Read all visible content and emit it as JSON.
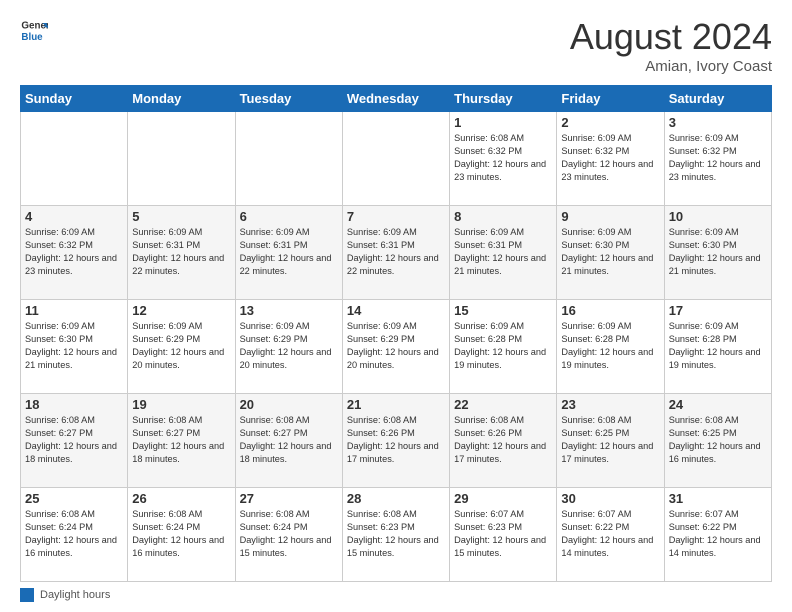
{
  "header": {
    "logo_line1": "General",
    "logo_line2": "Blue",
    "month_year": "August 2024",
    "location": "Amian, Ivory Coast"
  },
  "days_of_week": [
    "Sunday",
    "Monday",
    "Tuesday",
    "Wednesday",
    "Thursday",
    "Friday",
    "Saturday"
  ],
  "weeks": [
    [
      {
        "day": "",
        "info": ""
      },
      {
        "day": "",
        "info": ""
      },
      {
        "day": "",
        "info": ""
      },
      {
        "day": "",
        "info": ""
      },
      {
        "day": "1",
        "info": "Sunrise: 6:08 AM\nSunset: 6:32 PM\nDaylight: 12 hours\nand 23 minutes."
      },
      {
        "day": "2",
        "info": "Sunrise: 6:09 AM\nSunset: 6:32 PM\nDaylight: 12 hours\nand 23 minutes."
      },
      {
        "day": "3",
        "info": "Sunrise: 6:09 AM\nSunset: 6:32 PM\nDaylight: 12 hours\nand 23 minutes."
      }
    ],
    [
      {
        "day": "4",
        "info": "Sunrise: 6:09 AM\nSunset: 6:32 PM\nDaylight: 12 hours\nand 23 minutes."
      },
      {
        "day": "5",
        "info": "Sunrise: 6:09 AM\nSunset: 6:31 PM\nDaylight: 12 hours\nand 22 minutes."
      },
      {
        "day": "6",
        "info": "Sunrise: 6:09 AM\nSunset: 6:31 PM\nDaylight: 12 hours\nand 22 minutes."
      },
      {
        "day": "7",
        "info": "Sunrise: 6:09 AM\nSunset: 6:31 PM\nDaylight: 12 hours\nand 22 minutes."
      },
      {
        "day": "8",
        "info": "Sunrise: 6:09 AM\nSunset: 6:31 PM\nDaylight: 12 hours\nand 21 minutes."
      },
      {
        "day": "9",
        "info": "Sunrise: 6:09 AM\nSunset: 6:30 PM\nDaylight: 12 hours\nand 21 minutes."
      },
      {
        "day": "10",
        "info": "Sunrise: 6:09 AM\nSunset: 6:30 PM\nDaylight: 12 hours\nand 21 minutes."
      }
    ],
    [
      {
        "day": "11",
        "info": "Sunrise: 6:09 AM\nSunset: 6:30 PM\nDaylight: 12 hours\nand 21 minutes."
      },
      {
        "day": "12",
        "info": "Sunrise: 6:09 AM\nSunset: 6:29 PM\nDaylight: 12 hours\nand 20 minutes."
      },
      {
        "day": "13",
        "info": "Sunrise: 6:09 AM\nSunset: 6:29 PM\nDaylight: 12 hours\nand 20 minutes."
      },
      {
        "day": "14",
        "info": "Sunrise: 6:09 AM\nSunset: 6:29 PM\nDaylight: 12 hours\nand 20 minutes."
      },
      {
        "day": "15",
        "info": "Sunrise: 6:09 AM\nSunset: 6:28 PM\nDaylight: 12 hours\nand 19 minutes."
      },
      {
        "day": "16",
        "info": "Sunrise: 6:09 AM\nSunset: 6:28 PM\nDaylight: 12 hours\nand 19 minutes."
      },
      {
        "day": "17",
        "info": "Sunrise: 6:09 AM\nSunset: 6:28 PM\nDaylight: 12 hours\nand 19 minutes."
      }
    ],
    [
      {
        "day": "18",
        "info": "Sunrise: 6:08 AM\nSunset: 6:27 PM\nDaylight: 12 hours\nand 18 minutes."
      },
      {
        "day": "19",
        "info": "Sunrise: 6:08 AM\nSunset: 6:27 PM\nDaylight: 12 hours\nand 18 minutes."
      },
      {
        "day": "20",
        "info": "Sunrise: 6:08 AM\nSunset: 6:27 PM\nDaylight: 12 hours\nand 18 minutes."
      },
      {
        "day": "21",
        "info": "Sunrise: 6:08 AM\nSunset: 6:26 PM\nDaylight: 12 hours\nand 17 minutes."
      },
      {
        "day": "22",
        "info": "Sunrise: 6:08 AM\nSunset: 6:26 PM\nDaylight: 12 hours\nand 17 minutes."
      },
      {
        "day": "23",
        "info": "Sunrise: 6:08 AM\nSunset: 6:25 PM\nDaylight: 12 hours\nand 17 minutes."
      },
      {
        "day": "24",
        "info": "Sunrise: 6:08 AM\nSunset: 6:25 PM\nDaylight: 12 hours\nand 16 minutes."
      }
    ],
    [
      {
        "day": "25",
        "info": "Sunrise: 6:08 AM\nSunset: 6:24 PM\nDaylight: 12 hours\nand 16 minutes."
      },
      {
        "day": "26",
        "info": "Sunrise: 6:08 AM\nSunset: 6:24 PM\nDaylight: 12 hours\nand 16 minutes."
      },
      {
        "day": "27",
        "info": "Sunrise: 6:08 AM\nSunset: 6:24 PM\nDaylight: 12 hours\nand 15 minutes."
      },
      {
        "day": "28",
        "info": "Sunrise: 6:08 AM\nSunset: 6:23 PM\nDaylight: 12 hours\nand 15 minutes."
      },
      {
        "day": "29",
        "info": "Sunrise: 6:07 AM\nSunset: 6:23 PM\nDaylight: 12 hours\nand 15 minutes."
      },
      {
        "day": "30",
        "info": "Sunrise: 6:07 AM\nSunset: 6:22 PM\nDaylight: 12 hours\nand 14 minutes."
      },
      {
        "day": "31",
        "info": "Sunrise: 6:07 AM\nSunset: 6:22 PM\nDaylight: 12 hours\nand 14 minutes."
      }
    ]
  ],
  "legend": {
    "label": "Daylight hours"
  }
}
